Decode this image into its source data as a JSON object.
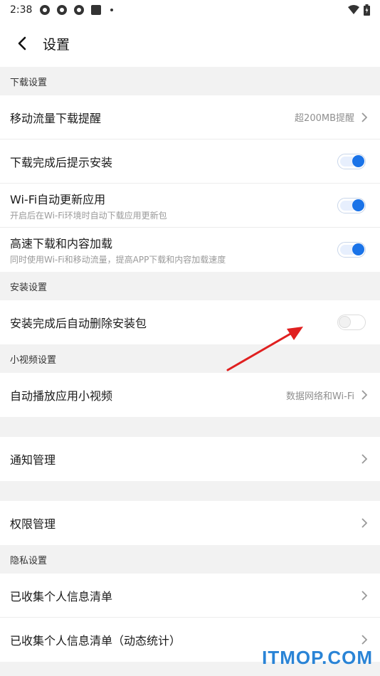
{
  "status_bar": {
    "time": "2:38",
    "icons": [
      "app-icon",
      "app-icon",
      "app-icon",
      "square-icon",
      "dot-icon"
    ],
    "right_icons": [
      "wifi-icon",
      "battery-icon"
    ]
  },
  "header": {
    "title": "设置"
  },
  "sections": {
    "download": {
      "title": "下载设置",
      "mobile_reminder": {
        "label": "移动流量下载提醒",
        "value": "超200MB提醒"
      },
      "prompt_install": {
        "label": "下载完成后提示安装",
        "toggle": true
      },
      "wifi_update": {
        "label": "Wi-Fi自动更新应用",
        "sub": "开启后在Wi-Fi环境时自动下载应用更新包",
        "toggle": true
      },
      "high_speed": {
        "label": "高速下载和内容加载",
        "sub": "同时使用Wi-Fi和移动流量，提高APP下载和内容加载速度",
        "toggle": true
      }
    },
    "install": {
      "title": "安装设置",
      "auto_delete": {
        "label": "安装完成后自动删除安装包",
        "toggle": false
      }
    },
    "video": {
      "title": "小视频设置",
      "autoplay": {
        "label": "自动播放应用小视频",
        "value": "数据网络和Wi-Fi"
      }
    },
    "notify": {
      "label": "通知管理"
    },
    "permission": {
      "label": "权限管理"
    },
    "privacy": {
      "title": "隐私设置",
      "collected": {
        "label": "已收集个人信息清单"
      },
      "collected_stats": {
        "label": "已收集个人信息清单（动态统计）"
      }
    }
  },
  "watermark": "ITMOP.COM",
  "colors": {
    "accent": "#1a73e8",
    "arrow": "#e02020",
    "watermark": "#2a84d6"
  }
}
